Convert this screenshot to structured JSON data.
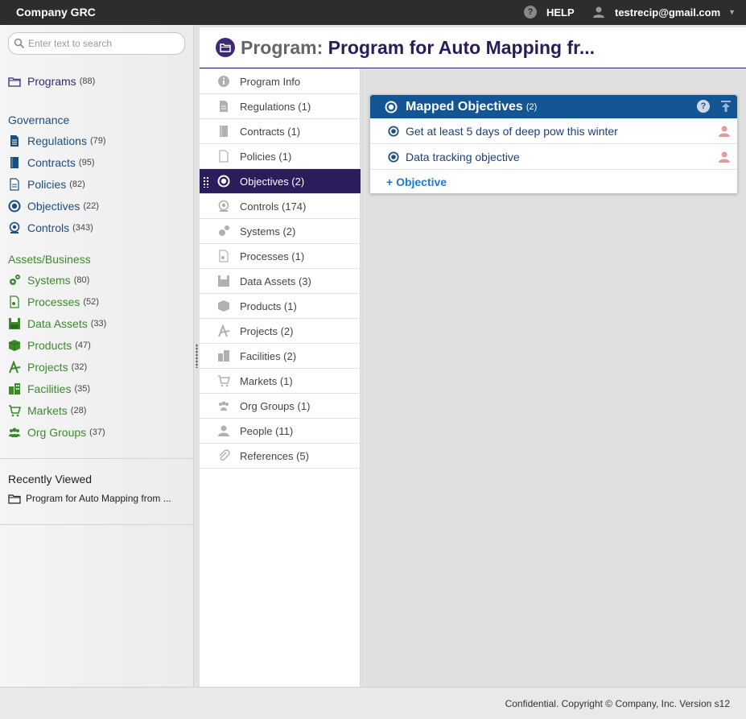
{
  "topbar": {
    "brand": "Company GRC",
    "help": "HELP",
    "user": "testrecip@gmail.com"
  },
  "search": {
    "placeholder": "Enter text to search"
  },
  "sidebar": {
    "programs": {
      "label": "Programs",
      "count": "(88)"
    },
    "governance_heading": "Governance",
    "governance": [
      {
        "label": "Regulations",
        "count": "(79)",
        "icon": "regulation-icon"
      },
      {
        "label": "Contracts",
        "count": "(95)",
        "icon": "contract-icon"
      },
      {
        "label": "Policies",
        "count": "(82)",
        "icon": "policy-icon"
      },
      {
        "label": "Objectives",
        "count": "(22)",
        "icon": "objective-icon"
      },
      {
        "label": "Controls",
        "count": "(343)",
        "icon": "control-icon"
      }
    ],
    "assets_heading": "Assets/Business",
    "assets": [
      {
        "label": "Systems",
        "count": "(80)",
        "icon": "system-icon"
      },
      {
        "label": "Processes",
        "count": "(52)",
        "icon": "process-icon"
      },
      {
        "label": "Data Assets",
        "count": "(33)",
        "icon": "data-asset-icon"
      },
      {
        "label": "Products",
        "count": "(47)",
        "icon": "product-icon"
      },
      {
        "label": "Projects",
        "count": "(32)",
        "icon": "project-icon"
      },
      {
        "label": "Facilities",
        "count": "(35)",
        "icon": "facility-icon"
      },
      {
        "label": "Markets",
        "count": "(28)",
        "icon": "market-icon"
      },
      {
        "label": "Org Groups",
        "count": "(37)",
        "icon": "org-group-icon"
      }
    ],
    "recent_heading": "Recently Viewed",
    "recent_item": "Program for Auto Mapping from ..."
  },
  "header": {
    "prefix": "Program:",
    "title": "Program for Auto Mapping fr..."
  },
  "tabs": [
    {
      "label": "Program Info",
      "icon": "info-icon"
    },
    {
      "label": "Regulations (1)",
      "icon": "regulation-icon"
    },
    {
      "label": "Contracts (1)",
      "icon": "contract-icon"
    },
    {
      "label": "Policies (1)",
      "icon": "policy-icon"
    },
    {
      "label": "Objectives (2)",
      "icon": "objective-icon",
      "active": true
    },
    {
      "label": "Controls (174)",
      "icon": "control-icon"
    },
    {
      "label": "Systems (2)",
      "icon": "system-icon"
    },
    {
      "label": "Processes (1)",
      "icon": "process-icon"
    },
    {
      "label": "Data Assets (3)",
      "icon": "data-asset-icon"
    },
    {
      "label": "Products (1)",
      "icon": "product-icon"
    },
    {
      "label": "Projects (2)",
      "icon": "project-icon"
    },
    {
      "label": "Facilities (2)",
      "icon": "facility-icon"
    },
    {
      "label": "Markets (1)",
      "icon": "market-icon"
    },
    {
      "label": "Org Groups (1)",
      "icon": "org-group-icon"
    },
    {
      "label": "People (11)",
      "icon": "person-icon"
    },
    {
      "label": "References (5)",
      "icon": "paperclip-icon"
    }
  ],
  "panel": {
    "title": "Mapped Objectives",
    "count": "(2)",
    "items": [
      {
        "label": "Get at least 5 days of deep pow this winter"
      },
      {
        "label": "Data tracking objective"
      }
    ],
    "add_label": "+ Objective"
  },
  "footer": {
    "text": "Confidential. Copyright © Company, Inc. Version s12"
  },
  "colors": {
    "topbar": "#2d2d2d",
    "accent_purple": "#2b1d5b",
    "panel_blue": "#145693",
    "governance": "#1b4e80",
    "assets": "#3a8a2b"
  }
}
